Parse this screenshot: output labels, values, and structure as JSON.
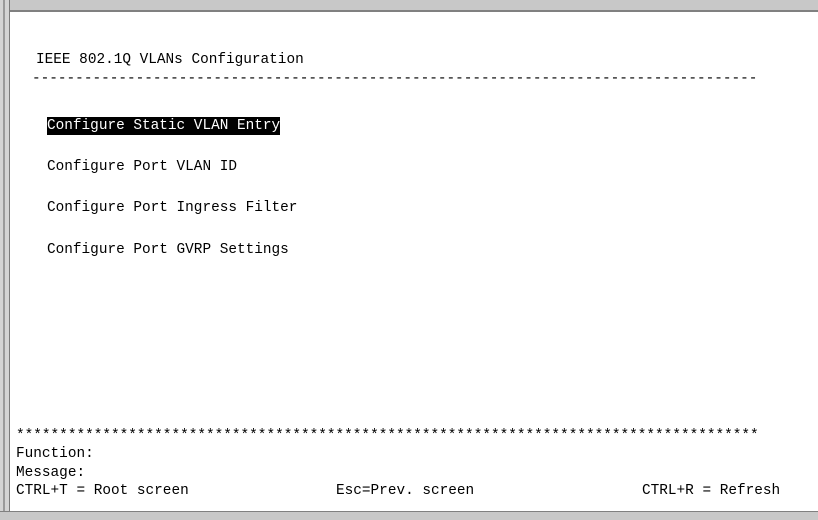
{
  "screen": {
    "title": "IEEE 802.1Q VLANs Configuration",
    "separator_dashes": "------------------------------------------------------------------------------------",
    "separator_stars": "**************************************************************************************"
  },
  "menu": {
    "items": [
      {
        "label": "Configure Static VLAN Entry",
        "selected": true
      },
      {
        "label": "Configure Port VLAN ID",
        "selected": false
      },
      {
        "label": "Configure Port Ingress Filter",
        "selected": false
      },
      {
        "label": "Configure Port GVRP Settings",
        "selected": false
      }
    ]
  },
  "footer": {
    "function_label": "Function:",
    "message_label": "Message:",
    "hint_root": "CTRL+T = Root screen",
    "hint_prev": "Esc=Prev. screen",
    "hint_refresh": "CTRL+R = Refresh"
  },
  "colors": {
    "background": "#ffffff",
    "text": "#000000",
    "selection_bg": "#000000",
    "selection_text": "#ffffff",
    "frame": "#c8c8c8"
  }
}
